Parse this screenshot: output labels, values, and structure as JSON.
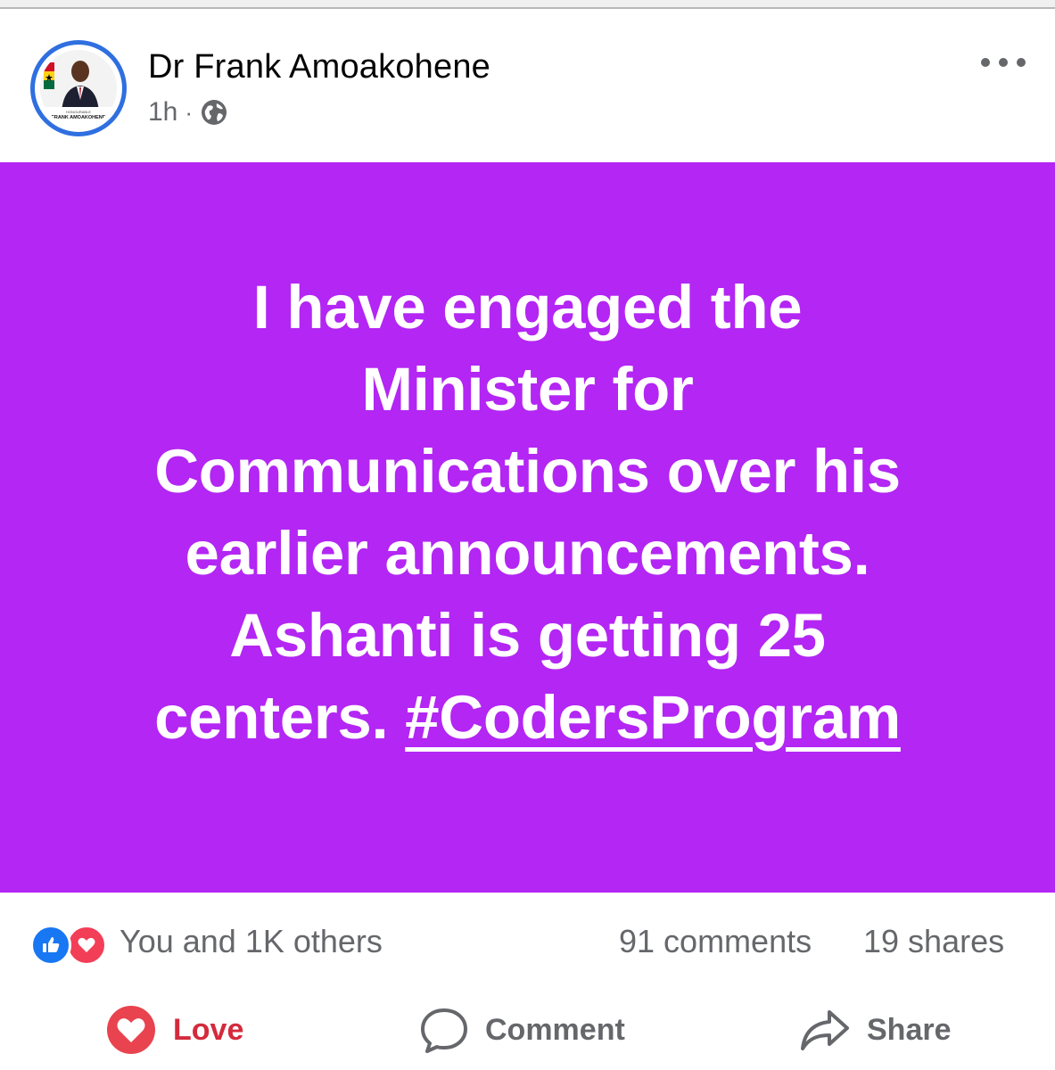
{
  "post": {
    "author": "Dr Frank Amoakohene",
    "time": "1h",
    "separator": "·",
    "privacy_icon": "globe-icon",
    "more_icon": "more-options-icon",
    "avatar_caption": "HONOURABLE FRANK AMOAKOHENE",
    "background_color": "#b326f3",
    "text_lines": [
      "I have engaged the",
      "Minister for",
      "Communications over his",
      "earlier announcements.",
      "Ashanti is getting 25"
    ],
    "last_line_prefix": "centers. ",
    "hashtag": "#CodersProgram"
  },
  "stats": {
    "reaction_types": [
      "like-icon",
      "love-icon"
    ],
    "reactions_text": "You and 1K others",
    "comments": "91 comments",
    "shares": "19 shares"
  },
  "actions": {
    "love": {
      "label": "Love",
      "icon": "heart-icon",
      "color": "#d42a3c"
    },
    "comment": {
      "label": "Comment",
      "icon": "comment-icon"
    },
    "share": {
      "label": "Share",
      "icon": "share-icon"
    }
  }
}
